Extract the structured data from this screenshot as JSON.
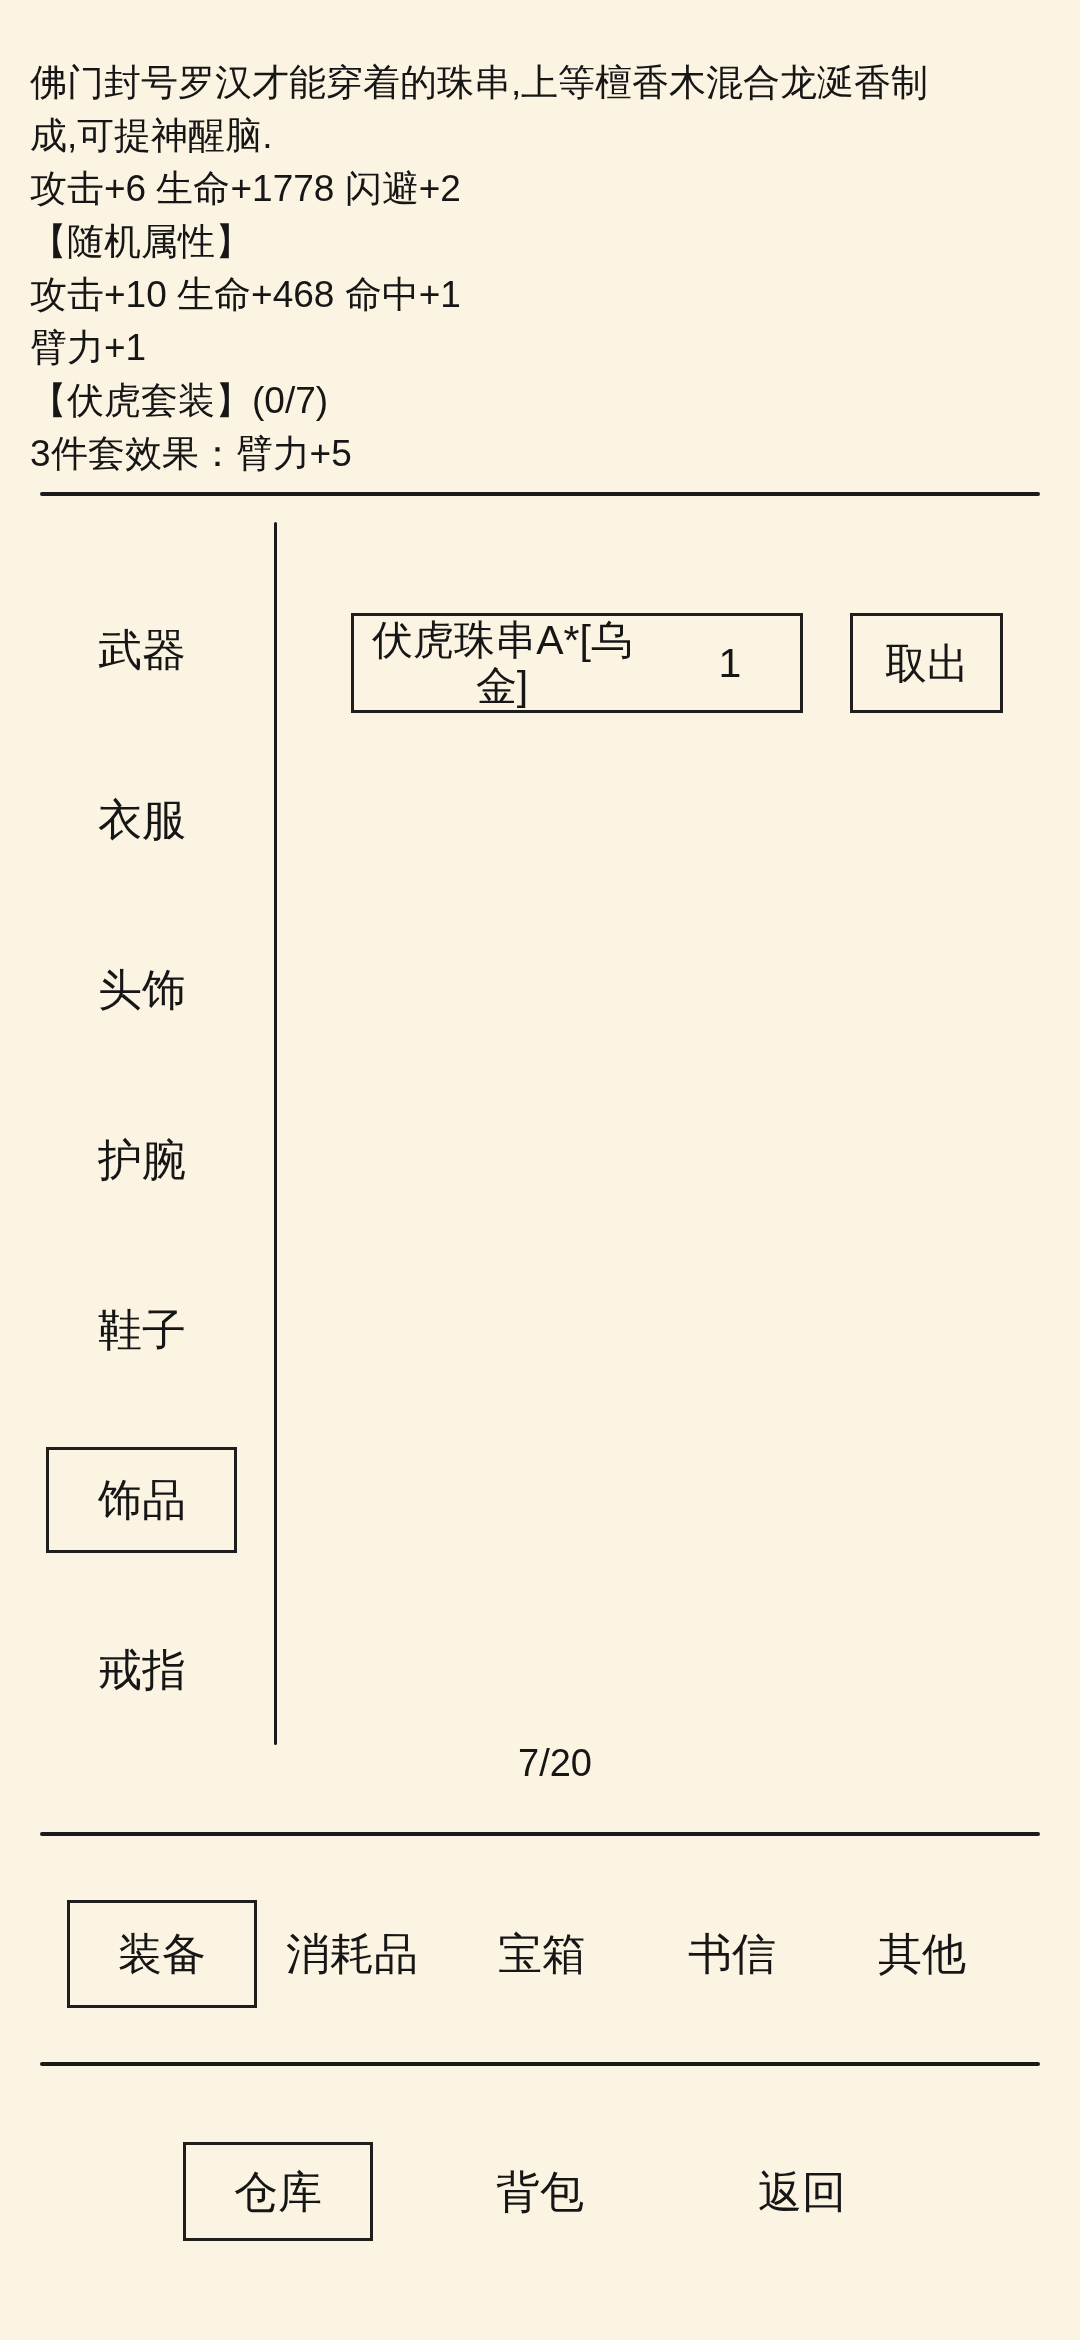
{
  "description": "佛门封号罗汉才能穿着的珠串,上等檀香木混合龙涎香制成,可提神醒脑.",
  "attributes": [
    "攻击+6 生命+1778 闪避+2",
    "【随机属性】",
    "攻击+10 生命+468 命中+1",
    "臂力+1",
    "【伏虎套装】(0/7)",
    "3件套效果：臂力+5"
  ],
  "categories": [
    {
      "label": "武器",
      "selected": false
    },
    {
      "label": "衣服",
      "selected": false
    },
    {
      "label": "头饰",
      "selected": false
    },
    {
      "label": "护腕",
      "selected": false
    },
    {
      "label": "鞋子",
      "selected": false
    },
    {
      "label": "饰品",
      "selected": true
    },
    {
      "label": "戒指",
      "selected": false
    }
  ],
  "items": [
    {
      "name": "伏虎珠串A*[乌金]",
      "count": "1",
      "action": "取出"
    }
  ],
  "page": "7/20",
  "tabs": [
    {
      "label": "装备",
      "selected": true
    },
    {
      "label": "消耗品",
      "selected": false
    },
    {
      "label": "宝箱",
      "selected": false
    },
    {
      "label": "书信",
      "selected": false
    },
    {
      "label": "其他",
      "selected": false
    }
  ],
  "nav": [
    {
      "label": "仓库",
      "selected": true
    },
    {
      "label": "背包",
      "selected": false
    },
    {
      "label": "返回",
      "selected": false
    }
  ]
}
